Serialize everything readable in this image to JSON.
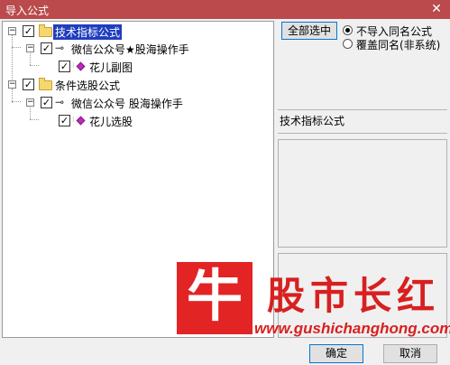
{
  "window": {
    "title": "导入公式",
    "close_glyph": "✕"
  },
  "tree": {
    "items": [
      {
        "label": "技术指标公式",
        "checked": true,
        "expander": "−"
      },
      {
        "label": "微信公众号★股海操作手",
        "checked": true,
        "expander": "−"
      },
      {
        "label": "花儿副图",
        "checked": true
      },
      {
        "label": "条件选股公式",
        "checked": true,
        "expander": "−"
      },
      {
        "label": "微信公众号 股海操作手",
        "checked": true,
        "expander": "−"
      },
      {
        "label": "花儿选股",
        "checked": true
      }
    ],
    "check_glyph": "✓"
  },
  "options": {
    "select_all_label": "全部选中",
    "radio1_label": "不导入同名公式",
    "radio2_label": "覆盖同名(非系统)",
    "selected": "radio1"
  },
  "info": {
    "section_label": "技术指标公式"
  },
  "footer": {
    "ok_label": "确定",
    "cancel_label": "取消"
  },
  "watermark": {
    "logo_char": "牛",
    "name": "股市长红",
    "url": "www.gushichanghong.com"
  },
  "colors": {
    "titlebar": "#ba4a4c",
    "selection": "#1f3dbf",
    "watermark": "#d91f1f"
  }
}
